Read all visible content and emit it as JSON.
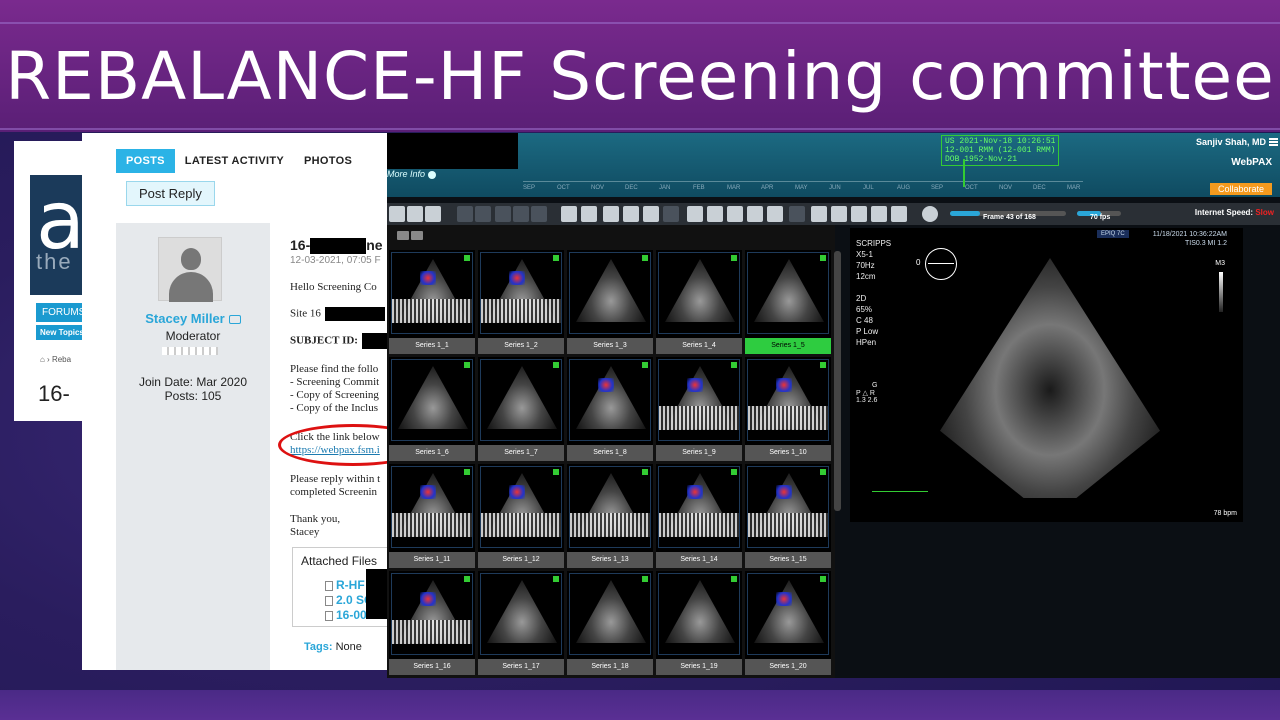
{
  "slide": {
    "title": "REBALANCE-HF Screening committee"
  },
  "background_site": {
    "logo_letter": "a",
    "logo_sub": "the",
    "forums_label": "FORUMS",
    "new_topics_label": "New Topics",
    "breadcrumb": "Reba",
    "post_number": "16-"
  },
  "forum": {
    "tabs": [
      {
        "label": "POSTS",
        "active": true
      },
      {
        "label": "LATEST ACTIVITY",
        "active": false
      },
      {
        "label": "PHOTOS",
        "active": false
      }
    ],
    "post_reply_label": "Post Reply",
    "author": {
      "name": "Stacey Miller",
      "role": "Moderator",
      "join_date": "Join Date: Mar 2020",
      "posts": "Posts: 105"
    },
    "post": {
      "title_prefix": "16-",
      "title_suffix": "ne",
      "date": "12-03-2021, 07:05 F",
      "greeting": "Hello Screening Co",
      "site_line": "Site 16",
      "subject_label": "SUBJECT ID:",
      "line_find": "Please find the follo",
      "bullet_1": "- Screening Commit",
      "bullet_2": "- Copy of Screening",
      "bullet_3": "- Copy of the Inclus",
      "click_link": "Click the link below",
      "link_url": "https://webpax.fsm.i",
      "reply_line_1": "Please reply within t",
      "reply_line_2": "completed Screenin",
      "thanks": "Thank you,",
      "signature": "Stacey"
    },
    "attachments": {
      "title": "Attached Files",
      "items": [
        "R-HF",
        "2.0 SC R",
        "16-001-R"
      ]
    },
    "tags_label": "Tags:",
    "tags_value": "None"
  },
  "webpax": {
    "more_info": "More Info",
    "header_box": [
      "US 2021-Nov-18 10:26:51",
      "12-001 RMM (12-001 RMM)",
      "DOB 1952-Nov-21"
    ],
    "user": "Sanjiv Shah, MD",
    "brand": "WebPAX",
    "collaborate_label": "Collaborate",
    "timeline_months": [
      "SEP",
      "OCT",
      "NOV",
      "DEC",
      "JAN",
      "FEB",
      "MAR",
      "APR",
      "MAY",
      "JUN",
      "JUL",
      "AUG",
      "SEP",
      "OCT",
      "NOV",
      "DEC",
      "MAR"
    ],
    "frame_label": "Frame 43 of 168",
    "frame_progress": 0.26,
    "fps_label": "70 fps",
    "fps_progress": 0.55,
    "internet_speed_label": "Internet Speed:",
    "internet_speed_value": "Slow",
    "series": [
      "Series 1_1",
      "Series 1_2",
      "Series 1_3",
      "Series 1_4",
      "Series 1_5",
      "Series 1_6",
      "Series 1_7",
      "Series 1_8",
      "Series 1_9",
      "Series 1_10",
      "Series 1_11",
      "Series 1_12",
      "Series 1_13",
      "Series 1_14",
      "Series 1_15",
      "Series 1_16",
      "Series 1_17",
      "Series 1_18",
      "Series 1_19",
      "Series 1_20"
    ],
    "selected_series": "Series 1_5",
    "viewer": {
      "info_lines": [
        "SCRIPPS",
        "X5-1",
        "70Hz",
        "12cm",
        "",
        "2D",
        "65%",
        "C 48",
        "P Low",
        "HPen"
      ],
      "badge": "EPIQ 7C",
      "right_info": [
        "11/18/2021   10:36:22AM",
        "TIS0.3    MI 1.2"
      ],
      "orientation": "0",
      "mode": "M3",
      "gauge_letter": "G",
      "gauge_p": "P",
      "gauge_r": "R",
      "gauge_values": "1.3   2.6",
      "bpm": "78 bpm"
    },
    "colors": {
      "accent": "#2aa6d8",
      "selected_green": "#2ecc40",
      "collaborate_orange": "#f49a1e",
      "slow_red": "#e22222"
    }
  }
}
